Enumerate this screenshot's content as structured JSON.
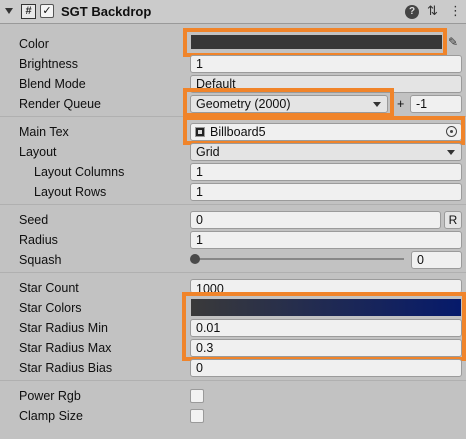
{
  "header": {
    "title": "SGT Backdrop",
    "script_glyph": "#",
    "enabled_glyph": "✓",
    "help_glyph": "?",
    "preset_glyph": "⇅",
    "more_glyph": "⋮"
  },
  "properties": {
    "color": {
      "label": "Color",
      "value_color": "#373737"
    },
    "brightness": {
      "label": "Brightness",
      "value": "1"
    },
    "blend_mode": {
      "label": "Blend Mode",
      "value": "Default"
    },
    "render_queue": {
      "label": "Render Queue",
      "value": "Geometry (2000)",
      "plus": "+",
      "offset": "-1"
    },
    "main_tex": {
      "label": "Main Tex",
      "value": "Billboard5"
    },
    "layout": {
      "label": "Layout",
      "value": "Grid"
    },
    "layout_columns": {
      "label": "Layout Columns",
      "value": "1"
    },
    "layout_rows": {
      "label": "Layout Rows",
      "value": "1"
    },
    "seed": {
      "label": "Seed",
      "value": "0",
      "randomize": "R"
    },
    "radius": {
      "label": "Radius",
      "value": "1"
    },
    "squash": {
      "label": "Squash",
      "value": "0",
      "slider_fraction": 0
    },
    "star_count": {
      "label": "Star Count",
      "value": "1000"
    },
    "star_colors": {
      "label": "Star Colors",
      "gradient_start": "#3a3a3a",
      "gradient_end": "#061a6b"
    },
    "star_radius_min": {
      "label": "Star Radius Min",
      "value": "0.01"
    },
    "star_radius_max": {
      "label": "Star Radius Max",
      "value": "0.3"
    },
    "star_radius_bias": {
      "label": "Star Radius Bias",
      "value": "0"
    },
    "power_rgb": {
      "label": "Power Rgb",
      "checked": false
    },
    "clamp_size": {
      "label": "Clamp Size",
      "checked": false
    }
  },
  "colors": {
    "highlight": "#f0842a",
    "panel": "#c2c2c2"
  }
}
